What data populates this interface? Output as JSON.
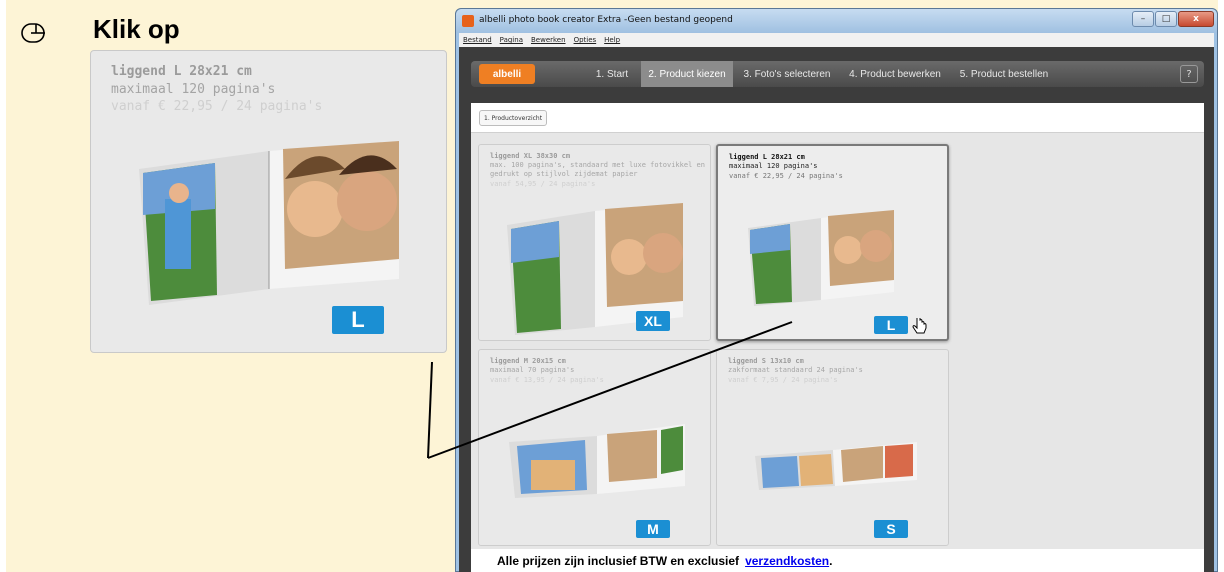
{
  "instruction": {
    "title": "Klik op"
  },
  "zoom_card": {
    "title": "liggend L 28x21 cm",
    "subtitle": "maximaal 120 pagina's",
    "price": "vanaf € 22,95 / 24 pagina's",
    "badge": "L"
  },
  "window": {
    "title": "albelli photo book creator Extra -Geen bestand geopend",
    "controls": {
      "minimize": "–",
      "maximize": "□",
      "close": "x"
    }
  },
  "menu": [
    "Bestand",
    "Pagina",
    "Bewerken",
    "Opties",
    "Help"
  ],
  "wizard": {
    "logo": "albelli",
    "steps": [
      "1. Start",
      "2. Product kiezen",
      "3. Foto's selecteren",
      "4. Product bewerken",
      "5. Product bestellen"
    ],
    "active_step": 1,
    "help": "?"
  },
  "subnav": {
    "overview_button": "1. Productoverzicht"
  },
  "products": [
    {
      "title": "liggend XL 38x30 cm",
      "desc": "max. 100 pagina's, standaard met luxe fotovikkel en gedrukt op stijlvol zijdemat papier",
      "price": "vanaf 54,95 / 24 pagina's",
      "badge": "XL"
    },
    {
      "title": "liggend L 28x21 cm",
      "desc": "maximaal 120 pagina's",
      "price": "vanaf € 22,95 / 24 pagina's",
      "badge": "L"
    },
    {
      "title": "liggend M 20x15 cm",
      "desc": "maximaal 70 pagina's",
      "price": "vanaf € 13,95 / 24 pagina's",
      "badge": "M"
    },
    {
      "title": "liggend S 13x10 cm",
      "desc": "zakformaat standaard 24 pagina's",
      "price": "vanaf € 7,95 / 24 pagina's",
      "badge": "S"
    }
  ],
  "footer": {
    "text": "Alle prijzen zijn inclusief BTW en exclusief",
    "link": "verzendkosten",
    "end": "."
  },
  "colors": {
    "badge": "#1b8fd3",
    "logo": "#ef7f23",
    "tutorial_bg": "#fdf4d6"
  }
}
